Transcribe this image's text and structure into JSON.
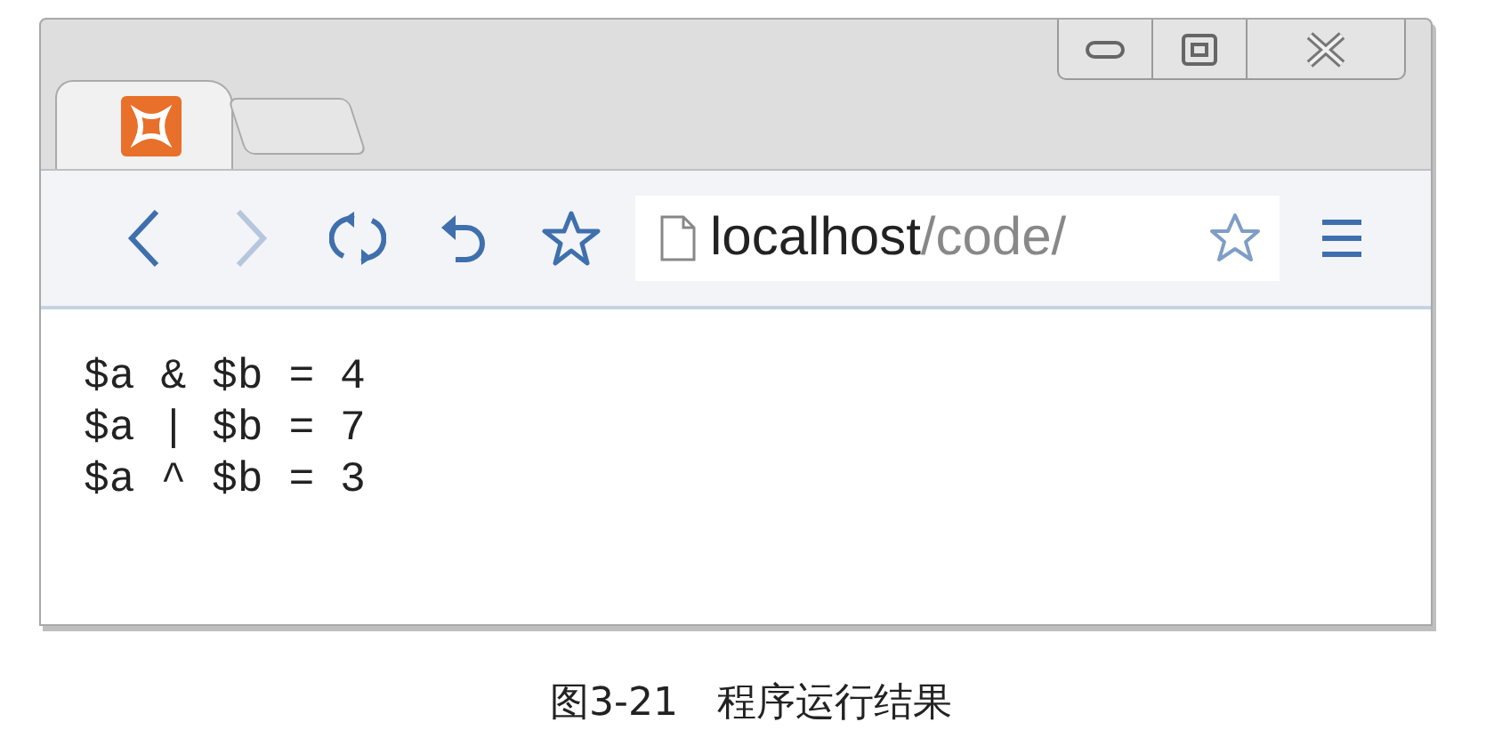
{
  "tabs": [
    {
      "selected": true
    }
  ],
  "nav": {
    "back": {
      "disabled": false
    },
    "forward": {
      "disabled": true
    }
  },
  "address": {
    "host": "localhost",
    "path": "/code/"
  },
  "output": [
    "$a & $b = 4",
    "$a | $b = 7",
    "$a ^ $b = 3"
  ],
  "caption": {
    "label": "图3-21",
    "text": "程序运行结果"
  }
}
